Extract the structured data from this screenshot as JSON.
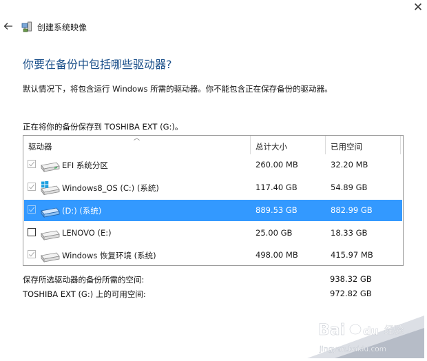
{
  "window": {
    "close_glyph": "✕",
    "title": "创建系统映像",
    "title_icon": "system-image-icon"
  },
  "heading": "你要在备份中包括哪些驱动器?",
  "description": "默认情况下，将包含运行 Windows 所需的驱动器。你不能包含正在保存备份的驱动器。",
  "saving_to": "正在将你的备份保存到 TOSHIBA EXT (G:)。",
  "table": {
    "headers": {
      "drive": "驱动器",
      "total": "总计大小",
      "used": "已用空间"
    },
    "rows": [
      {
        "name": "EFI 系统分区",
        "total": "260.00 MB",
        "used": "32.20 MB",
        "checked": true,
        "disabled": true,
        "icon": "drive-icon"
      },
      {
        "name": "Windows8_OS (C:) (系统)",
        "total": "117.40 GB",
        "used": "54.89 GB",
        "checked": true,
        "disabled": true,
        "icon": "windows-drive-icon"
      },
      {
        "name": "(D:) (系统)",
        "total": "889.53 GB",
        "used": "882.99 GB",
        "checked": true,
        "disabled": true,
        "selected": true,
        "icon": "drive-icon"
      },
      {
        "name": "LENOVO (E:)",
        "total": "25.00 GB",
        "used": "18.33 GB",
        "checked": false,
        "disabled": false,
        "icon": "drive-icon"
      },
      {
        "name": "Windows 恢复环境 (系统)",
        "total": "498.00 MB",
        "used": "415.97 MB",
        "checked": true,
        "disabled": true,
        "icon": "drive-icon"
      }
    ]
  },
  "summary": {
    "required_label": "保存所选驱动器的备份所需的空间:",
    "required_value": "938.32 GB",
    "available_label": "TOSHIBA EXT (G:) 上的可用空间:",
    "available_value": "972.82 GB"
  },
  "watermark": {
    "brand": "Bai",
    "brand_suffix": "du",
    "sub": "经验",
    "url": "jingyan.baidu.com"
  }
}
